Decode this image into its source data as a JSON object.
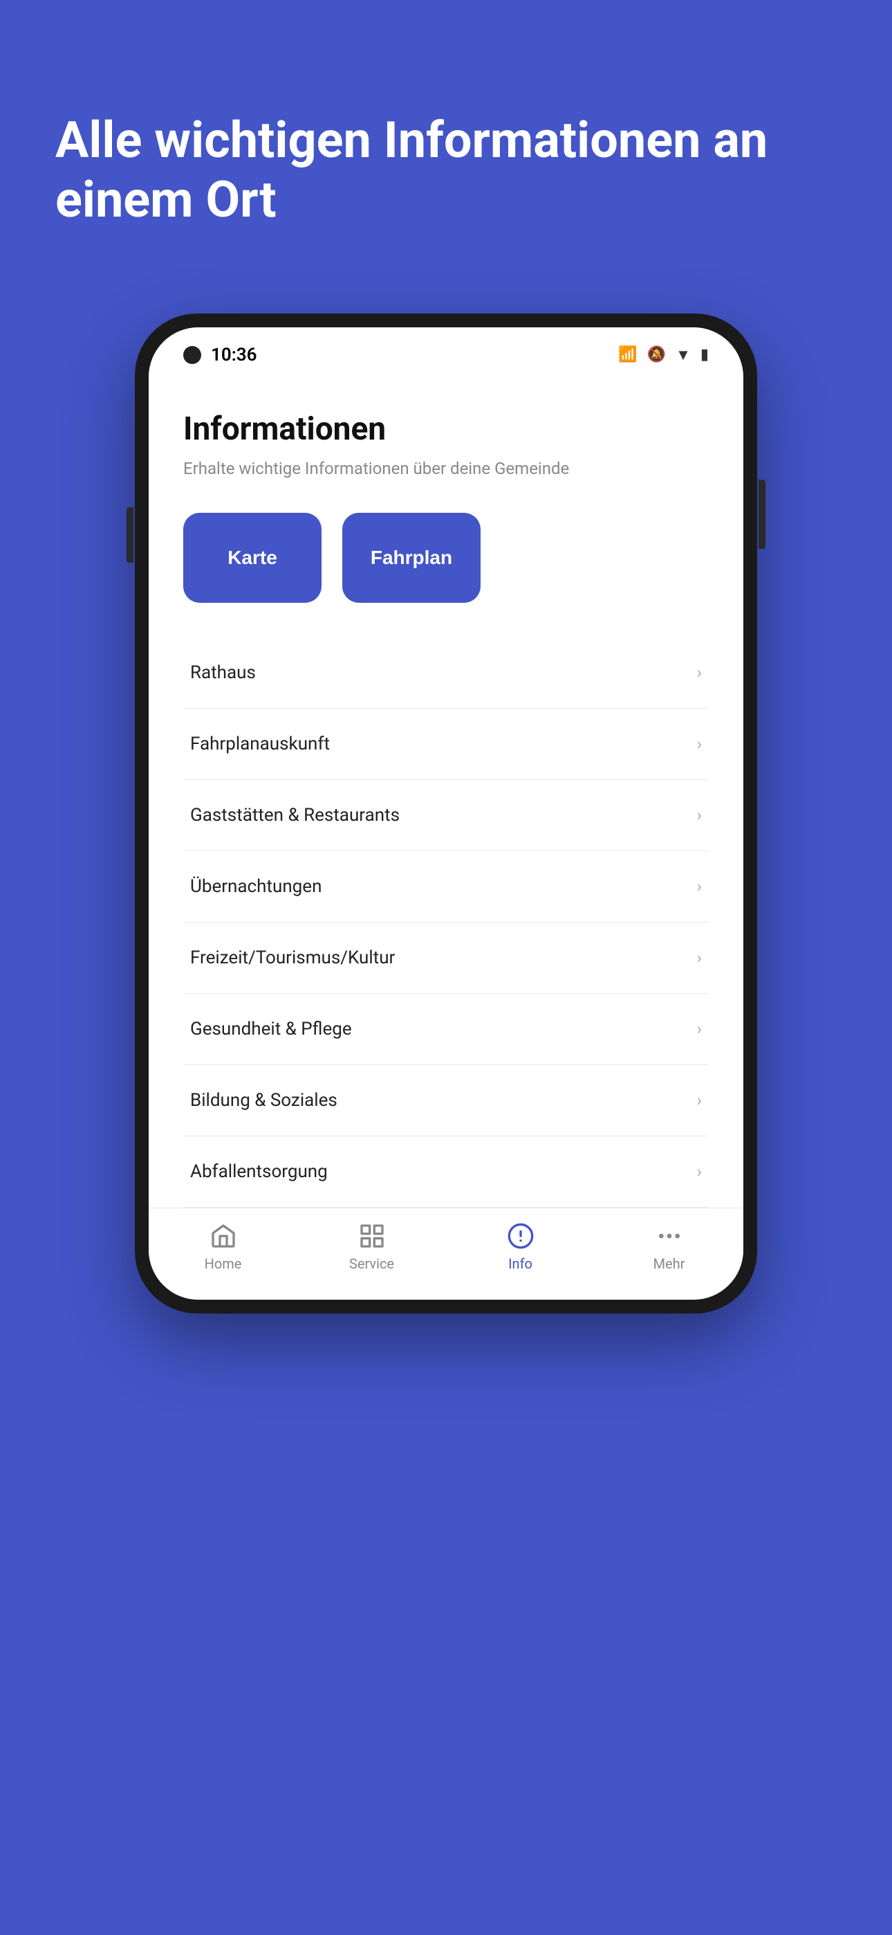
{
  "hero": {
    "title": "Alle wichtigen Informationen an einem Ort",
    "background_color": "#4355c7"
  },
  "phone": {
    "status_bar": {
      "time": "10:36",
      "icons": [
        "bluetooth",
        "mute",
        "wifi",
        "battery"
      ]
    },
    "app": {
      "title": "Informationen",
      "subtitle": "Erhalte wichtige Informationen über deine Gemeinde",
      "quick_actions": [
        {
          "label": "Karte",
          "id": "karte"
        },
        {
          "label": "Fahrplan",
          "id": "fahrplan"
        }
      ],
      "list_items": [
        {
          "label": "Rathaus",
          "id": "rathaus"
        },
        {
          "label": "Fahrplanauskunft",
          "id": "fahrplanauskunft"
        },
        {
          "label": "Gaststätten & Restaurants",
          "id": "gaststätten"
        },
        {
          "label": "Übernachtungen",
          "id": "übernachtungen"
        },
        {
          "label": "Freizeit/Tourismus/Kultur",
          "id": "freizeit"
        },
        {
          "label": "Gesundheit & Pflege",
          "id": "gesundheit"
        },
        {
          "label": "Bildung & Soziales",
          "id": "bildung"
        },
        {
          "label": "Abfallentsorgung",
          "id": "abfall"
        }
      ],
      "bottom_nav": [
        {
          "label": "Home",
          "icon": "home",
          "active": false,
          "id": "home"
        },
        {
          "label": "Service",
          "icon": "grid",
          "active": false,
          "id": "service"
        },
        {
          "label": "Info",
          "icon": "info",
          "active": true,
          "id": "info"
        },
        {
          "label": "Mehr",
          "icon": "more",
          "active": false,
          "id": "mehr"
        }
      ]
    }
  }
}
